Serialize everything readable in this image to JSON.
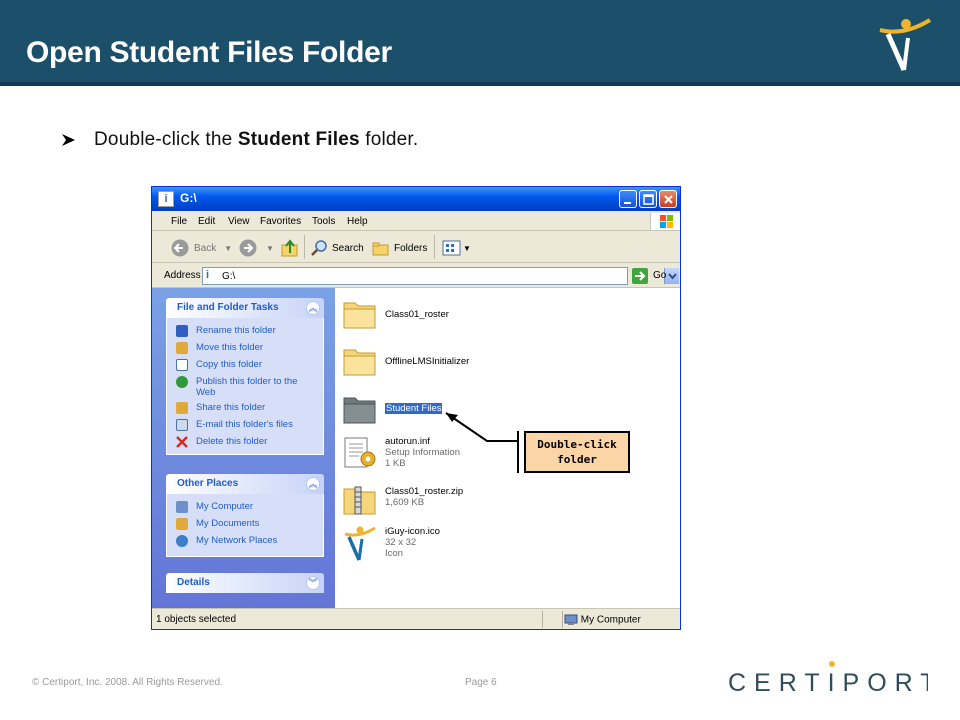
{
  "slide": {
    "title": "Open Student Files Folder",
    "bullet_prefix": "Double-click the ",
    "bullet_bold": "Student Files",
    "bullet_suffix": " folder.",
    "footer_copyright": "© Certiport, Inc. 2008. All Rights Reserved.",
    "footer_page": "Page 6",
    "brand": "CERTIPORT"
  },
  "window": {
    "title": "G:\\",
    "menu": [
      "File",
      "Edit",
      "View",
      "Favorites",
      "Tools",
      "Help"
    ],
    "toolbar": {
      "back": "Back",
      "search": "Search",
      "folders": "Folders"
    },
    "address": {
      "label": "Address",
      "value": "G:\\",
      "go": "Go"
    }
  },
  "sidebar": {
    "file_tasks": {
      "header": "File and Folder Tasks",
      "items": [
        "Rename this folder",
        "Move this folder",
        "Copy this folder",
        "Publish this folder to the Web",
        "Share this folder",
        "E-mail this folder's files",
        "Delete this folder"
      ]
    },
    "other_places": {
      "header": "Other Places",
      "items": [
        "My Computer",
        "My Documents",
        "My Network Places"
      ]
    },
    "details": {
      "header": "Details"
    }
  },
  "files": [
    {
      "name": "Class01_roster"
    },
    {
      "name": "OfflineLMSInitializer"
    },
    {
      "name": "Student Files"
    },
    {
      "name": "autorun.inf",
      "line2": "Setup Information",
      "line3": "1 KB"
    },
    {
      "name": "Class01_roster.zip",
      "line2": "1,609 KB"
    },
    {
      "name": "iGuy-icon.ico",
      "line2": "32 x 32",
      "line3": "Icon"
    }
  ],
  "status": {
    "left": "1 objects selected",
    "right": "My Computer"
  },
  "callout": {
    "line1": "Double-click",
    "line2": "folder"
  },
  "colors": {
    "header_bg": "#1b4f6a",
    "xp_blue": "#0058ee",
    "callout_bg": "#fbd5a6",
    "selection": "#316ac5"
  }
}
